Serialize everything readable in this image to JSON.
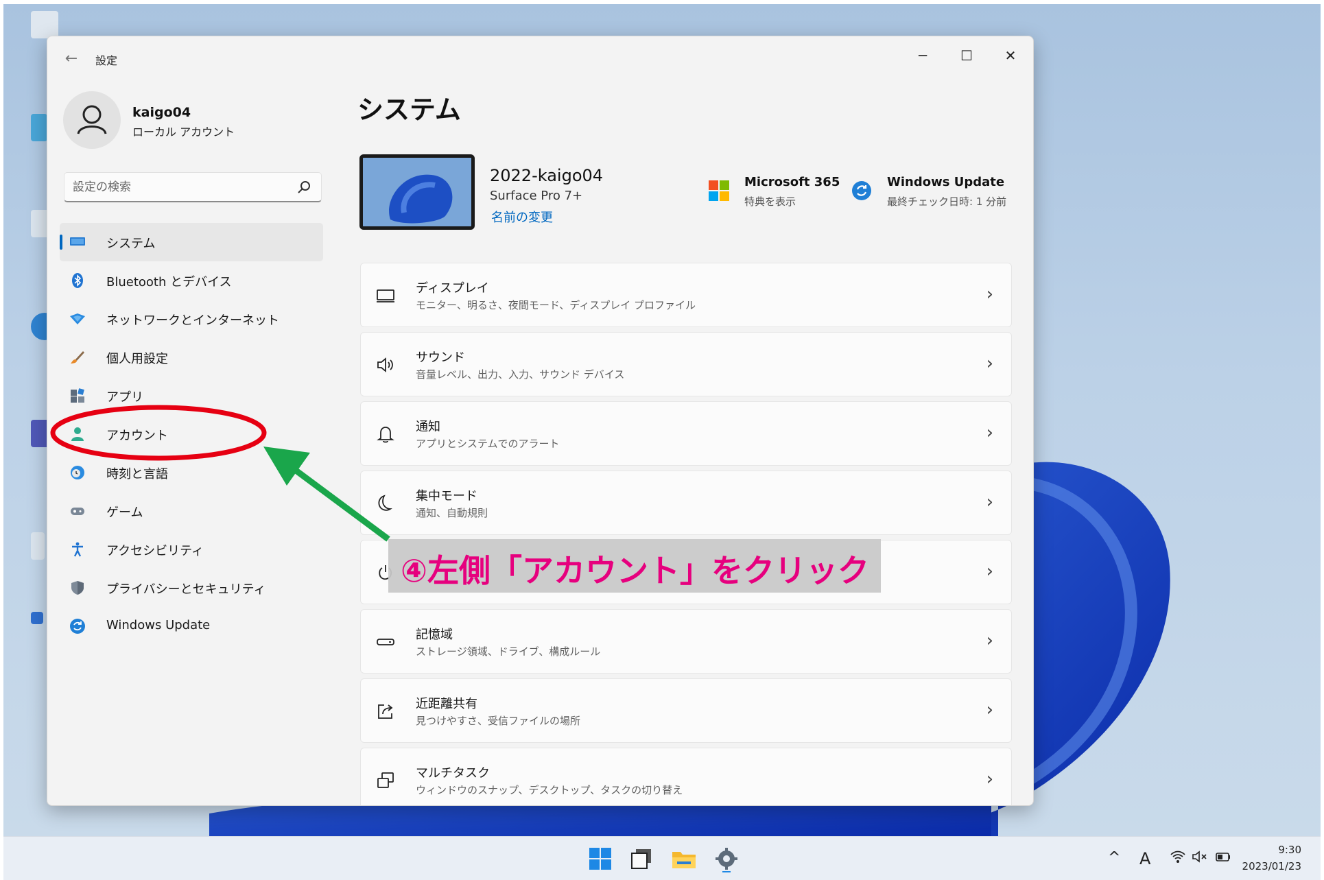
{
  "window": {
    "title": "設定",
    "back_glyph": "←",
    "minimize_glyph": "─",
    "maximize_glyph": "☐",
    "close_glyph": "✕"
  },
  "profile": {
    "name": "kaigo04",
    "account_type": "ローカル アカウント"
  },
  "search": {
    "placeholder": "設定の検索"
  },
  "sidebar": {
    "items": [
      {
        "label": "システム",
        "icon": "monitor-icon",
        "active": true
      },
      {
        "label": "Bluetooth とデバイス",
        "icon": "bluetooth-icon"
      },
      {
        "label": "ネットワークとインターネット",
        "icon": "wifi-diamond-icon"
      },
      {
        "label": "個人用設定",
        "icon": "brush-icon"
      },
      {
        "label": "アプリ",
        "icon": "apps-icon"
      },
      {
        "label": "アカウント",
        "icon": "person-icon"
      },
      {
        "label": "時刻と言語",
        "icon": "globe-clock-icon"
      },
      {
        "label": "ゲーム",
        "icon": "gamepad-icon"
      },
      {
        "label": "アクセシビリティ",
        "icon": "accessibility-icon"
      },
      {
        "label": "プライバシーとセキュリティ",
        "icon": "shield-icon"
      },
      {
        "label": "Windows Update",
        "icon": "update-icon"
      }
    ]
  },
  "main": {
    "page_title": "システム",
    "device": {
      "name": "2022-kaigo04",
      "model": "Surface Pro 7+",
      "rename_label": "名前の変更"
    },
    "ms365": {
      "title": "Microsoft 365",
      "subtitle": "特典を表示"
    },
    "windows_update": {
      "title": "Windows Update",
      "subtitle": "最終チェック日時: 1 分前"
    },
    "cards": [
      {
        "title": "ディスプレイ",
        "subtitle": "モニター、明るさ、夜間モード、ディスプレイ プロファイル",
        "icon": "display-icon"
      },
      {
        "title": "サウンド",
        "subtitle": "音量レベル、出力、入力、サウンド デバイス",
        "icon": "speaker-icon"
      },
      {
        "title": "通知",
        "subtitle": "アプリとシステムでのアラート",
        "icon": "bell-icon"
      },
      {
        "title": "集中モード",
        "subtitle": "通知、自動規則",
        "icon": "moon-icon"
      },
      {
        "title": "",
        "subtitle": "",
        "icon": "power-icon"
      },
      {
        "title": "記憶域",
        "subtitle": "ストレージ領域、ドライブ、構成ルール",
        "icon": "storage-icon"
      },
      {
        "title": "近距離共有",
        "subtitle": "見つけやすさ、受信ファイルの場所",
        "icon": "share-icon"
      },
      {
        "title": "マルチタスク",
        "subtitle": "ウィンドウのスナップ、デスクトップ、タスクの切り替え",
        "icon": "multitask-icon"
      }
    ],
    "chevron_glyph": "›"
  },
  "annotation": {
    "text": "④左側「アカウント」をクリック",
    "color": "#e6007e",
    "ring_color": "#e60012",
    "arrow_color": "#1aa64b"
  },
  "taskbar": {
    "tray": {
      "chevron_glyph": "^",
      "ime_glyph": "A",
      "time": "9:30",
      "date": "2023/01/23"
    }
  },
  "colors": {
    "accent": "#0067c0",
    "window_bg": "#f3f3f3"
  }
}
